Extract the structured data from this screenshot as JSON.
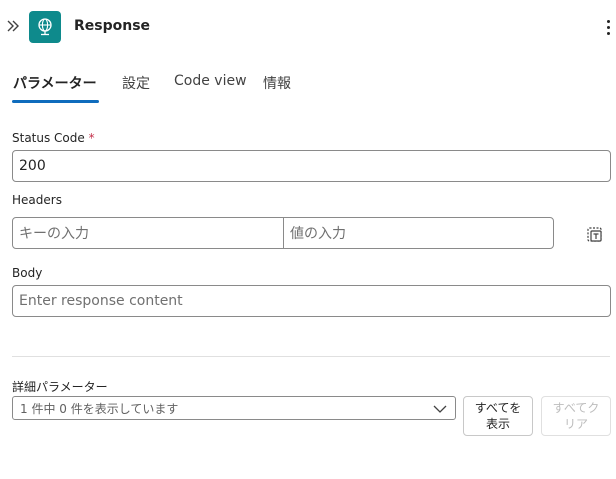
{
  "header": {
    "title": "Response",
    "collapse_icon": "chevron-double-right-icon",
    "action_icon": "globe-icon",
    "action_icon_color": "#0e8a8c",
    "more_icon": "more-vertical-icon"
  },
  "tabs": [
    {
      "label": "パラメーター",
      "active": true
    },
    {
      "label": "設定",
      "active": false
    },
    {
      "label": "Code view",
      "active": false
    },
    {
      "label": "情報",
      "active": false
    }
  ],
  "accent_color": "#0f6cbd",
  "form": {
    "status_code": {
      "label": "Status Code",
      "required_mark": "*",
      "value": "200"
    },
    "headers": {
      "label": "Headers",
      "key_placeholder": "キーの入力",
      "value_placeholder": "値の入力",
      "mode_icon": "switch-to-text-mode-icon"
    },
    "body": {
      "label": "Body",
      "placeholder": "Enter response content"
    }
  },
  "advanced": {
    "label": "詳細パラメーター",
    "select_value": "1 件中 0 件を表示しています",
    "show_all_line1": "すべてを",
    "show_all_line2": "表示",
    "clear_all_line1": "すべてク",
    "clear_all_line2": "リア"
  }
}
